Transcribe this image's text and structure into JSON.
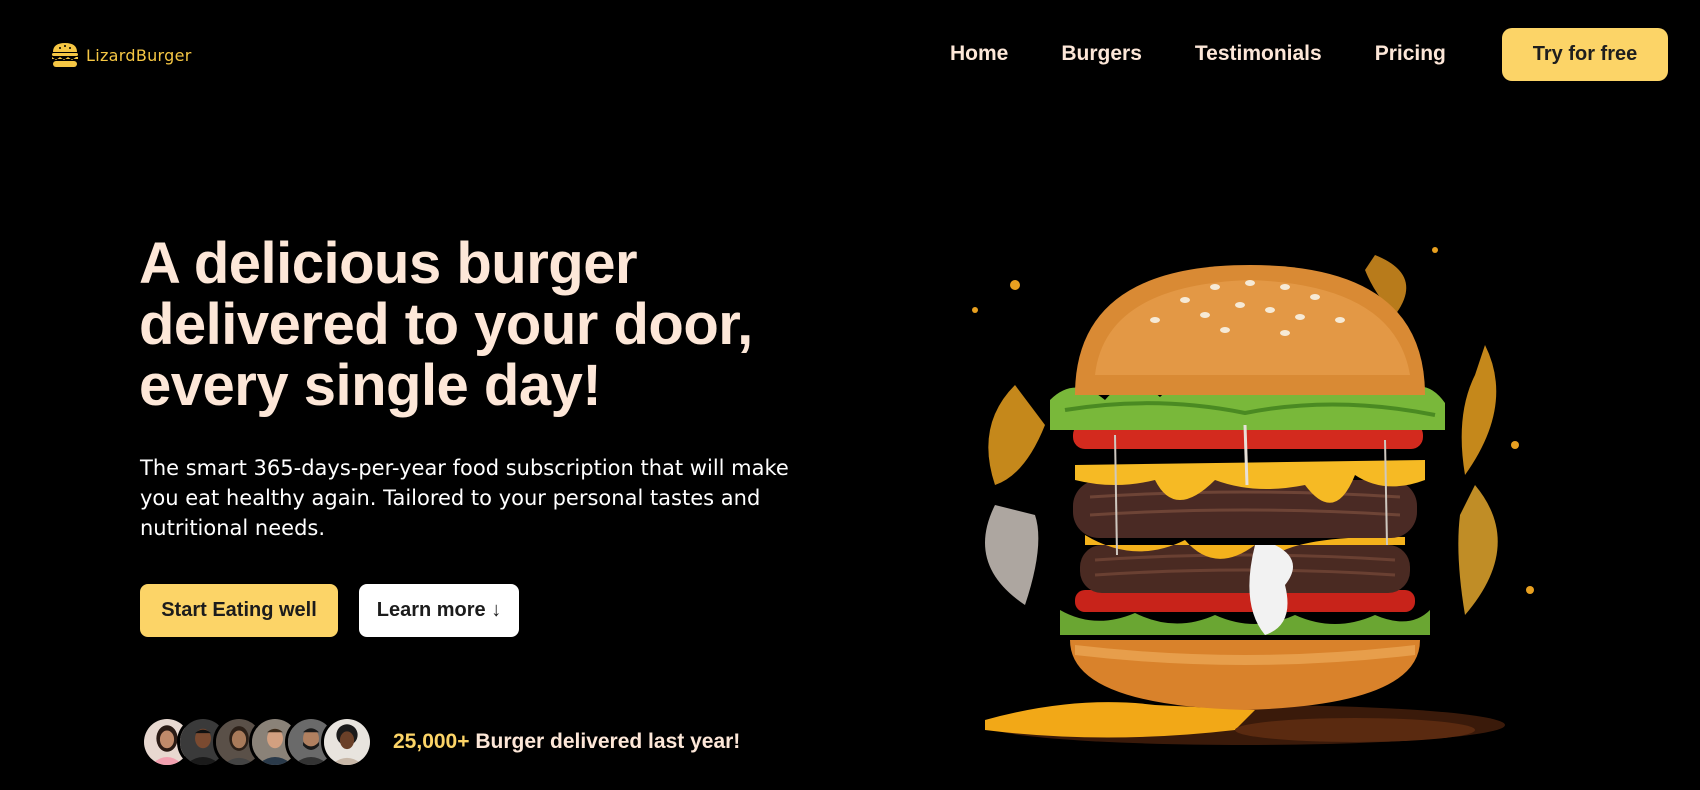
{
  "brand": {
    "name": "LizardBurger",
    "accent": "#fcd467",
    "logo_icon": "burger-icon"
  },
  "nav": {
    "links": [
      "Home",
      "Burgers",
      "Testimonials",
      "Pricing"
    ],
    "cta": "Try for free"
  },
  "hero": {
    "title_lines": [
      "A delicious burger",
      "delivered to your door,",
      "every single day!"
    ],
    "subtitle": "The smart 365-days-per-year food subscription that will make you eat healthy again. Tailored to your personal tastes and nutritional needs.",
    "primary_button": "Start Eating well",
    "secondary_button": "Learn more ↓"
  },
  "social_proof": {
    "count": "25,000+",
    "text": " Burger delivered last year!",
    "avatar_count": 6
  },
  "colors": {
    "background": "#000000",
    "heading": "#fde7d8",
    "button_yellow": "#fcd467",
    "button_white": "#ffffff"
  }
}
